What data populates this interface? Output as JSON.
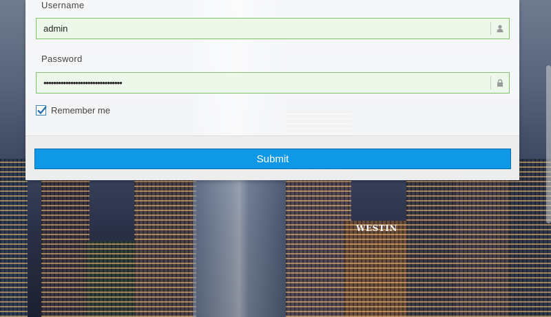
{
  "login": {
    "username_label": "Username",
    "username_value": "admin",
    "password_label": "Password",
    "password_value": "••••••••••••••••••••••••••••••••",
    "remember_label": "Remember me",
    "remember_checked": true,
    "submit_label": "Submit"
  },
  "background": {
    "sign_text": "WESTIN"
  },
  "icons": {
    "username_addon": "user-icon",
    "password_addon": "lock-icon"
  },
  "colors": {
    "field_border": "#7cc46a",
    "field_bg": "#eef8ea",
    "submit_bg": "#0f98e6",
    "checkbox_border": "#3a7fbf"
  }
}
